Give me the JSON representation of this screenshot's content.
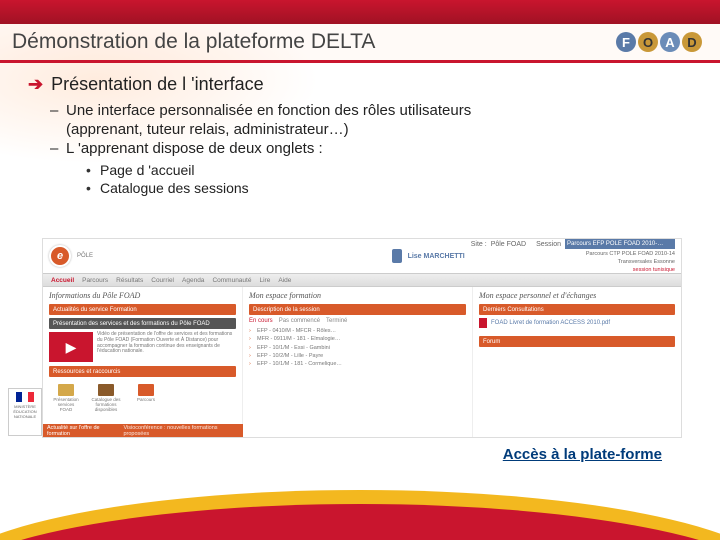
{
  "title": "Démonstration de la plateforme DELTA",
  "logo": {
    "f": "F",
    "o": "O",
    "a": "A",
    "d": "D"
  },
  "heading": "Présentation de l 'interface",
  "bullets": {
    "b1a": "Une interface personnalisée en fonction des rôles utilisateurs",
    "b1b": "(apprenant, tuteur relais, administrateur…)",
    "b2": "L 'apprenant dispose de deux onglets :",
    "sub1": "Page d 'accueil",
    "sub2": "Catalogue des sessions"
  },
  "screenshot": {
    "pole": "PÔLE",
    "user": "Lise MARCHETTI",
    "site_label": "Site :",
    "site_value": "Pôle FOAD",
    "session_label": "Session",
    "session_sel": "Parcours EFP POLE FOAD 2010-…",
    "session_sub1": "Parcours CTP POLE FOAD 2010-14",
    "session_sub2": "Transversales Essonne",
    "nav": [
      "Accueil",
      "Parcours",
      "Résultats",
      "Courriel",
      "Agenda",
      "Communauté",
      "Lire",
      "Aide"
    ],
    "col1_title": "Informations du Pôle FOAD",
    "col2_title": "Mon espace formation",
    "col3_title": "Mon espace personnel et d'échanges",
    "band_actu": "Actualités du service Formation",
    "band_pres": "Présentation des services et des formations du Pôle FOAD",
    "pres_text": "Vidéo de présentation de l'offre de services et des formations du Pôle FOAD (Formation Ouverte et À Distance) pour accompagner la formation continue des enseignants de l'éducation nationale.",
    "band_res": "Ressources et raccourcis",
    "res": [
      "Présentation services FOAD",
      "Catalogue des formations disponibles",
      "Parcours"
    ],
    "band_actualite": "Actualité sur l'offre de formation",
    "actualite_sub": "Visioconférence : nouvelles formations proposées",
    "band_desc": "Description de la session",
    "tabs": [
      "En cours",
      "Pas commencé",
      "Terminé"
    ],
    "courses": [
      "EFP - 0410/M - MFCR - Rôles…",
      "MFR - 0911/M - 181 - Elmalogie…",
      "EFP - 10/1/M - Essi - Gambini",
      "EFP - 10/2/M - Lille - Payre",
      "EFP - 10/1/M - 181 - Cormelique…"
    ],
    "band_docs": "Derniers Consultations",
    "doc": "FOAD Livret de formation ACCESS 2010.pdf",
    "band_forum": "Forum",
    "session_tunisique": "session tunisique"
  },
  "access_link": "Accès à la plate-forme"
}
